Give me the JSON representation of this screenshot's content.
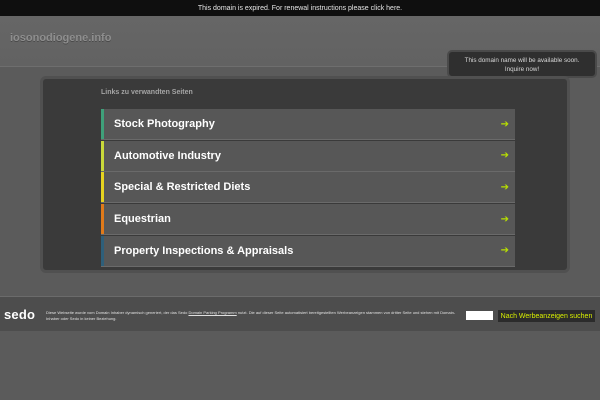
{
  "topbar": {
    "notice": "This domain is expired. For renewal instructions please click here."
  },
  "header": {
    "domain": "iosonodiogene.info",
    "inquire_line1": "This domain name will be available soon.",
    "inquire_line2": "Inquire now!"
  },
  "main": {
    "heading": "Links zu verwandten Seiten",
    "links": [
      {
        "label": "Stock Photography",
        "accent": "#3fa07a"
      },
      {
        "label": "Automotive Industry",
        "accent": "#c9d93a"
      },
      {
        "label": "Special & Restricted Diets",
        "accent": "#e6d320"
      },
      {
        "label": "Equestrian",
        "accent": "#e07a1a"
      },
      {
        "label": "Property Inspections & Appraisals",
        "accent": "#2e5f7a"
      }
    ],
    "arrow_icon": "➔"
  },
  "footer": {
    "logo": "sedo",
    "text_before": "Diese Webseite wurde vom Domain Inhaber dynamisch generiert, der das Sedo ",
    "text_link": "Domain Parking Programm",
    "text_after": " nutzt. Die auf dieser Seite automatisiert bereitgestellten Werbeanzeigen stammen von dritter Seite und stehen mit Domain-Inhaber oder Sedo in keiner Beziehung.",
    "ads_label": "Nach Werbeanzeigen suchen"
  },
  "colors": {
    "link_arrow": "#b8e000",
    "ads_text": "#d8f000"
  }
}
